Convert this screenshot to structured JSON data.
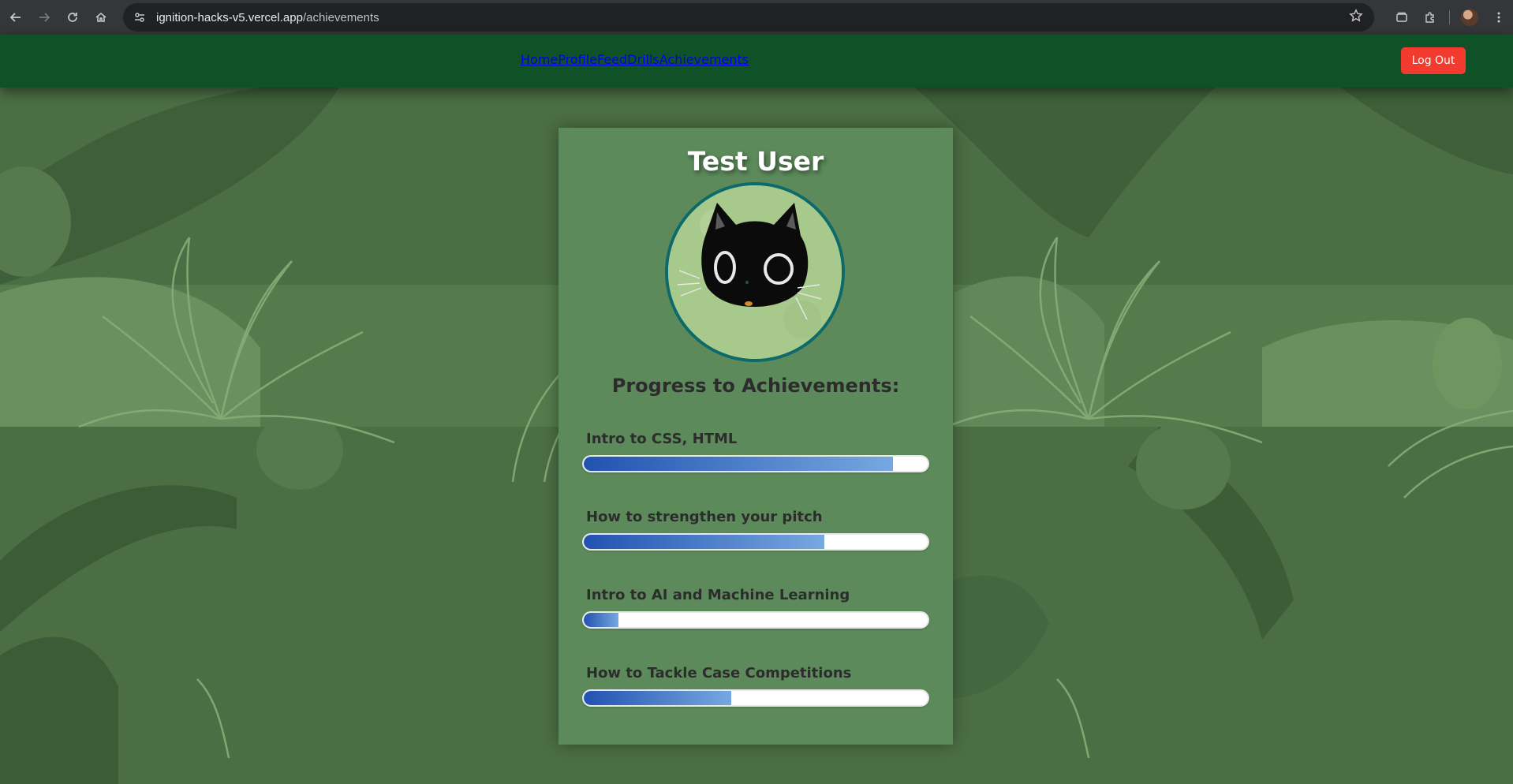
{
  "browser": {
    "url_domain": "ignition-hacks-v5.vercel.app",
    "url_path": "/achievements"
  },
  "nav": {
    "items": [
      {
        "label": "Home"
      },
      {
        "label": "Profile"
      },
      {
        "label": "Feed"
      },
      {
        "label": "Drills"
      },
      {
        "label": "Achievements"
      }
    ],
    "logout_label": "Log Out"
  },
  "profile": {
    "name": "Test User"
  },
  "achievements": {
    "title": "Progress to Achievements:",
    "items": [
      {
        "label": "Intro to CSS, HTML",
        "progress": 0.9
      },
      {
        "label": "How to strengthen your pitch",
        "progress": 0.7
      },
      {
        "label": "Intro to AI and Machine Learning",
        "progress": 0.1
      },
      {
        "label": "How to Tackle Case Competitions",
        "progress": 0.43
      }
    ]
  },
  "colors": {
    "header": "#0f5228",
    "logout": "#f23a2e",
    "card": "#5c8a5b",
    "background": "#4a6e43",
    "bar_start": "#2252b0",
    "bar_end": "#76a8e0"
  }
}
